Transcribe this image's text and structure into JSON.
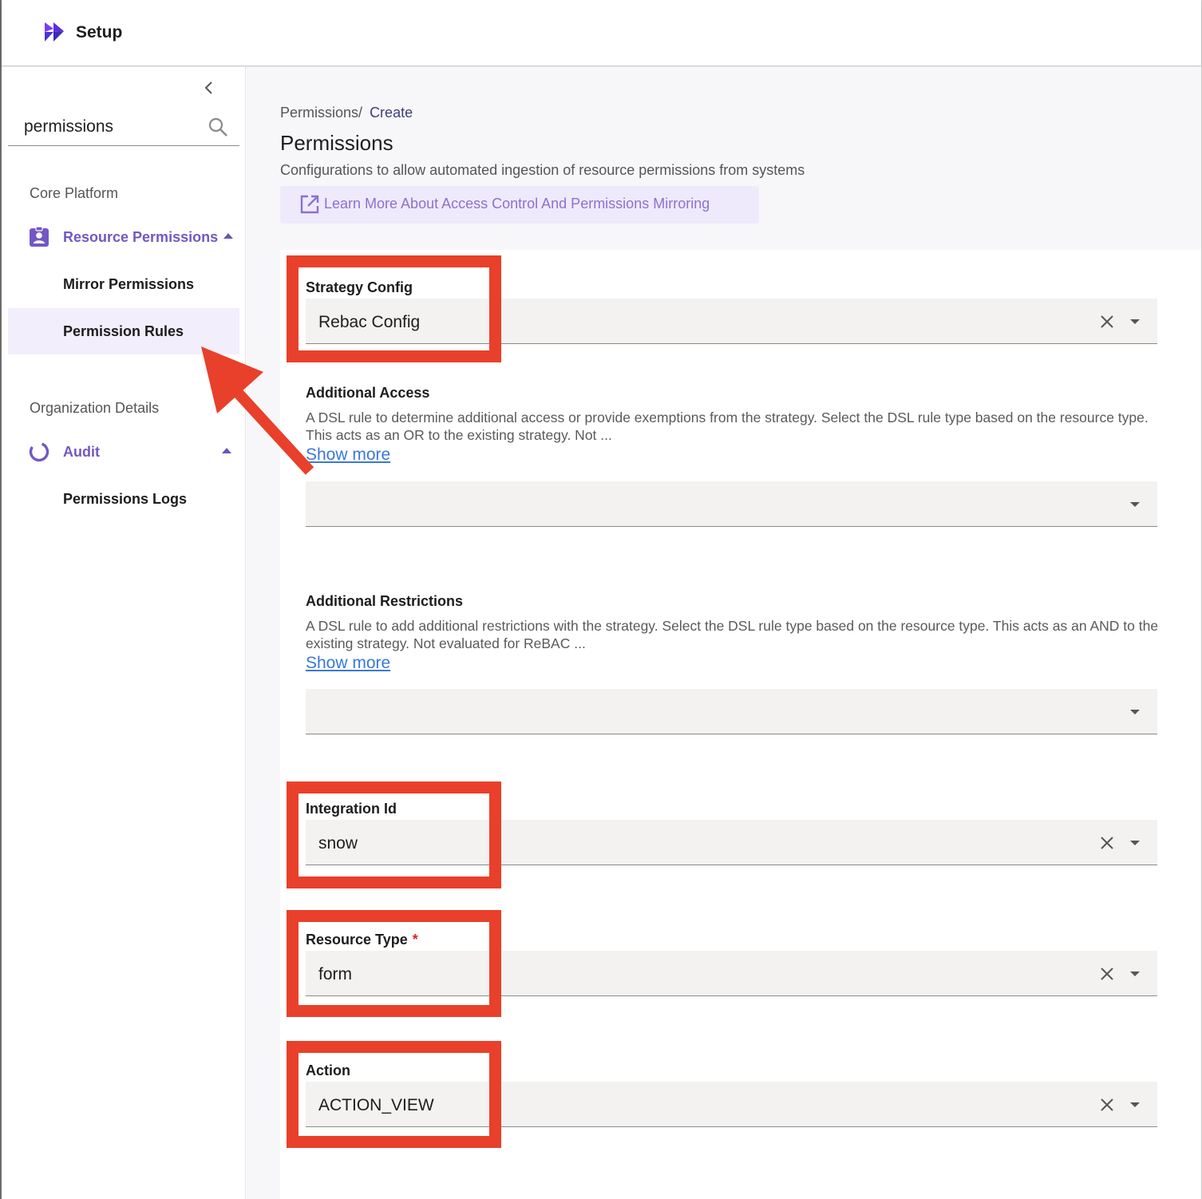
{
  "header": {
    "title": "Setup"
  },
  "sidebar": {
    "search": {
      "value": "permissions"
    },
    "sections": [
      {
        "label": "Core Platform",
        "parent": {
          "label": "Resource Permissions",
          "icon": "badge-icon"
        },
        "children": [
          {
            "label": "Mirror Permissions",
            "active": false
          },
          {
            "label": "Permission Rules",
            "active": true
          }
        ]
      },
      {
        "label": "Organization Details",
        "parent": {
          "label": "Audit",
          "icon": "audit-ring-icon"
        },
        "children": [
          {
            "label": "Permissions Logs",
            "active": false
          }
        ]
      }
    ]
  },
  "breadcrumb": {
    "parent": "Permissions",
    "separator": "/",
    "current": "Create"
  },
  "page": {
    "title": "Permissions",
    "description": "Configurations to allow automated ingestion of resource permissions from systems",
    "learn_more": "Learn More About Access Control And Permissions Mirroring"
  },
  "form": {
    "strategy_config": {
      "label": "Strategy Config",
      "value": "Rebac Config"
    },
    "additional_access": {
      "label": "Additional Access",
      "description": "A DSL rule to determine additional access or provide exemptions from the strategy. Select the DSL rule type based on the resource type. This acts as an OR to the existing strategy. Not ...",
      "show_more": "Show more",
      "value": ""
    },
    "additional_restrictions": {
      "label": "Additional Restrictions",
      "description": "A DSL rule to add additional restrictions with the strategy. Select the DSL rule type based on the resource type. This acts as an AND to the existing strategy. Not evaluated for ReBAC ...",
      "show_more": "Show more",
      "value": ""
    },
    "integration_id": {
      "label": "Integration Id",
      "value": "snow"
    },
    "resource_type": {
      "label": "Resource Type",
      "required_mark": "*",
      "value": "form"
    },
    "action": {
      "label": "Action",
      "value": "ACTION_VIEW"
    }
  },
  "colors": {
    "accent": "#7357c4",
    "annotation": "#e8402a",
    "link": "#3a78d6",
    "active_nav_bg": "#f2eefc"
  }
}
